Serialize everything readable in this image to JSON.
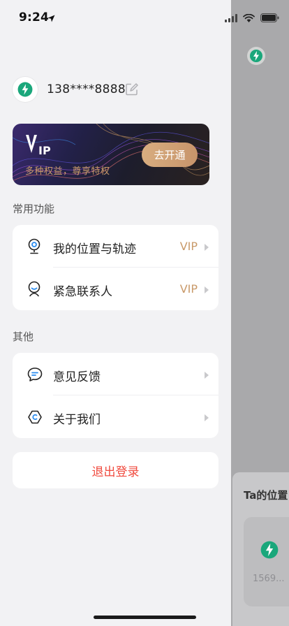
{
  "status_bar": {
    "time": "9:24"
  },
  "profile": {
    "phone": "138****8888"
  },
  "vip_card": {
    "logo_text": "IP",
    "subtitle": "多种权益，尊享特权",
    "button_label": "去开通"
  },
  "sections": {
    "common": {
      "title": "常用功能",
      "items": [
        {
          "label": "我的位置与轨迹",
          "badge": "VIP",
          "icon": "location-pin-icon"
        },
        {
          "label": "紧急联系人",
          "badge": "VIP",
          "icon": "contact-person-icon"
        }
      ]
    },
    "other": {
      "title": "其他",
      "items": [
        {
          "label": "意见反馈",
          "icon": "chat-bubble-icon"
        },
        {
          "label": "关于我们",
          "icon": "hexagon-icon"
        }
      ]
    }
  },
  "logout_label": "退出登录",
  "background_page": {
    "section_title": "Ta的位置",
    "contact_phone": "1569..."
  },
  "colors": {
    "brand_green": "#1aa77b",
    "vip_gold": "#c99a6a",
    "logout_red": "#f04a3e",
    "icon_blue": "#2a8cf0"
  }
}
